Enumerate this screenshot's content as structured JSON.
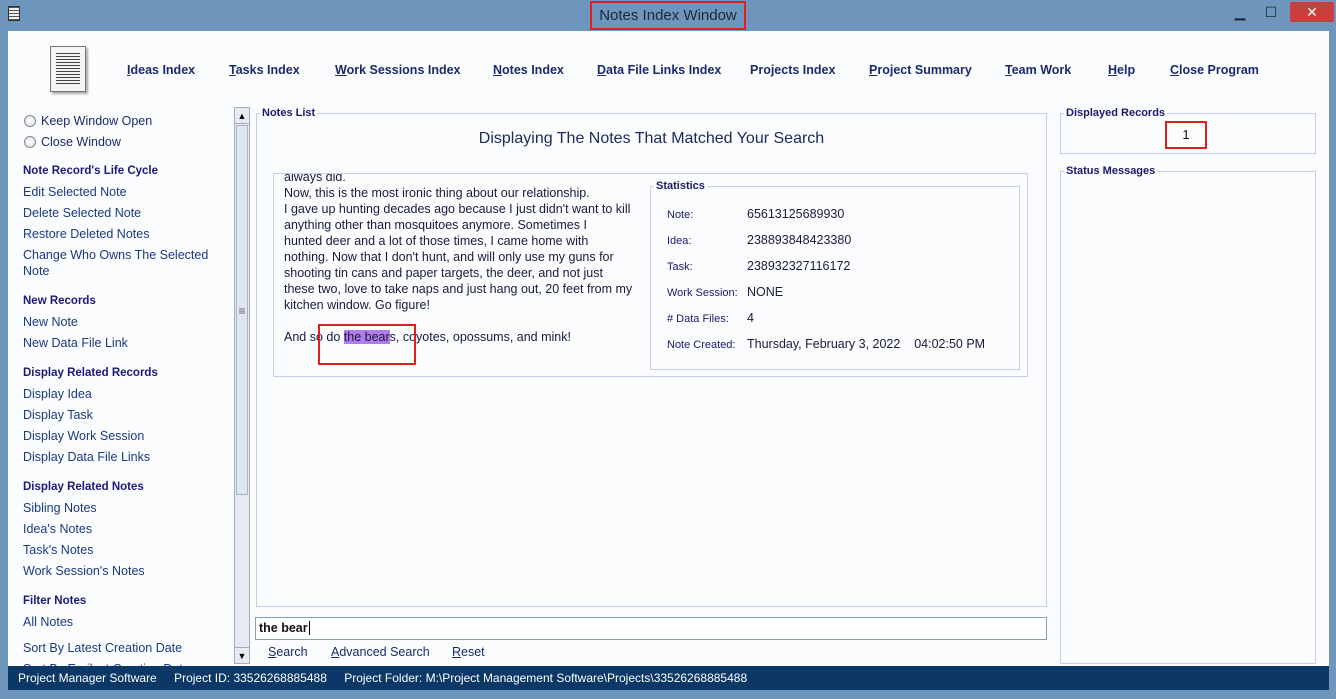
{
  "window": {
    "title": "Notes Index Window",
    "minimize": "▁",
    "maximize": "☐",
    "close": "✕"
  },
  "nav": [
    {
      "u": "I",
      "rest": "deas Index"
    },
    {
      "u": "T",
      "rest": "asks Index"
    },
    {
      "u": "W",
      "rest": "ork Sessions Index"
    },
    {
      "u": "N",
      "rest": "otes Index"
    },
    {
      "u": "D",
      "rest": "ata File Links Index"
    },
    {
      "u": "",
      "rest": "Projects Index"
    },
    {
      "u": "P",
      "rest": "roject Summary"
    },
    {
      "u": "T",
      "rest": "eam Work"
    },
    {
      "u": "H",
      "rest": "elp"
    },
    {
      "u": "C",
      "rest": "lose Program"
    }
  ],
  "sidebar": {
    "radios": [
      "Keep Window Open",
      "Close Window"
    ],
    "sections": [
      {
        "heading": "Note Record's Life Cycle",
        "items": [
          "Edit Selected Note",
          "Delete Selected Note",
          "Restore Deleted Notes",
          "Change Who Owns The Selected Note"
        ]
      },
      {
        "heading": "New Records",
        "items": [
          "New Note",
          "New Data File Link"
        ]
      },
      {
        "heading": "Display Related Records",
        "items": [
          "Display Idea",
          "Display Task",
          "Display Work Session",
          "Display Data File Links"
        ]
      },
      {
        "heading": "Display Related Notes",
        "items": [
          "Sibling Notes",
          "Idea's Notes",
          "Task's Notes",
          "Work Session's Notes"
        ]
      },
      {
        "heading": "Filter Notes",
        "items": [
          "All Notes",
          "Sort By Latest Creation Date",
          "Sort By Earilest Creation Date"
        ]
      }
    ]
  },
  "notes_list": {
    "legend": "Notes List",
    "heading": "Displaying The Notes That Matched Your Search",
    "text_lines": [
      "always did.",
      "Now, this is the most ironic thing about our relationship.",
      "I gave up hunting decades ago because I just didn't want to kill",
      "anything other than mosquitoes anymore. Sometimes I",
      "hunted deer and a lot of those times, I came home with",
      "nothing. Now that I don't hunt, and will only use my guns for",
      "shooting tin cans and paper targets, the deer, and not just",
      "these two, love to take naps and just hang out, 20 feet from my",
      "kitchen window. Go figure!"
    ],
    "last_before": "And so do ",
    "last_highlight": "the bear",
    "last_after": "s, coyotes, opossums, and mink!",
    "highlight_color": "#b07cf0",
    "statistics": {
      "legend": "Statistics",
      "rows": [
        {
          "label": "Note:",
          "value": "65613125689930"
        },
        {
          "label": "Idea:",
          "value": "238893848423380"
        },
        {
          "label": "Task:",
          "value": "238932327116172"
        },
        {
          "label": "Work Session:",
          "value": "NONE"
        },
        {
          "label": "# Data Files:",
          "value": "4"
        },
        {
          "label": "Note Created:",
          "value": "Thursday, February 3, 2022    04:02:50 PM"
        }
      ]
    }
  },
  "search": {
    "value": "the bear",
    "buttons": [
      {
        "u": "S",
        "rest": "earch"
      },
      {
        "u": "A",
        "rest": "dvanced Search"
      },
      {
        "u": "R",
        "rest": "eset"
      }
    ]
  },
  "displayed_records": {
    "legend": "Displayed Records",
    "value": "1"
  },
  "status_messages": {
    "legend": "Status Messages"
  },
  "statusbar": {
    "app": "Project Manager Software",
    "project_id_label": "Project ID:",
    "project_id": "33526268885488",
    "folder_label": "Project Folder:",
    "folder": "M:\\Project Management Software\\Projects\\33526268885488"
  }
}
